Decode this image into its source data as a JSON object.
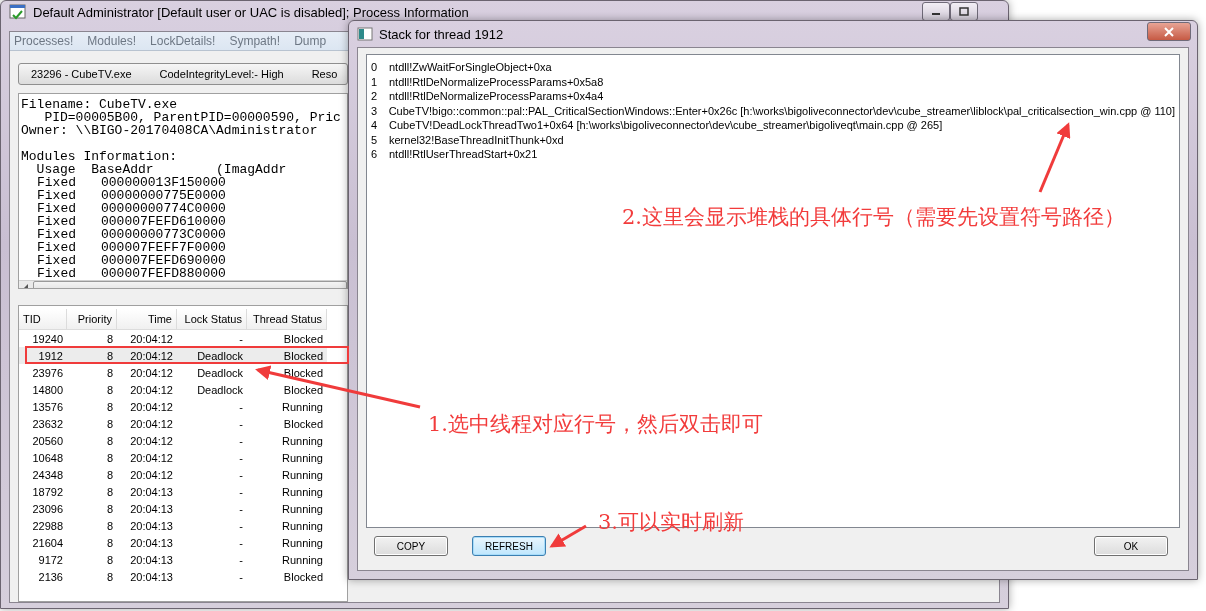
{
  "main_window": {
    "title": "Default Administrator [Default user or UAC is disabled]; Process Information",
    "menu": [
      "Processes!",
      "Modules!",
      "LockDetails!",
      "Sympath!",
      "Dump"
    ],
    "process_bar": [
      "23296 - CubeTV.exe",
      "CodeIntegrityLevel:- High",
      "Reso"
    ],
    "file_info": [
      "Filename: CubeTV.exe",
      "   PID=00005B00, ParentPID=00000590, Pric",
      "Owner: \\\\BIGO-20170408CA\\Administrator"
    ],
    "modules_heading": "Modules Information:",
    "modules_header": "  Usage  BaseAddr        (ImagAddr",
    "modules": [
      {
        "usage": "Fixed",
        "base": "000000013F150000"
      },
      {
        "usage": "Fixed",
        "base": "00000000775E0000"
      },
      {
        "usage": "Fixed",
        "base": "00000000774C0000"
      },
      {
        "usage": "Fixed",
        "base": "000007FEFD610000"
      },
      {
        "usage": "Fixed",
        "base": "00000000773C0000"
      },
      {
        "usage": "Fixed",
        "base": "000007FEFF7F0000"
      },
      {
        "usage": "Fixed",
        "base": "000007FEFD690000"
      },
      {
        "usage": "Fixed",
        "base": "000007FEFD880000"
      }
    ],
    "thread_columns": [
      "TID",
      "Priority",
      "Time",
      "Lock Status",
      "Thread Status"
    ],
    "threads": [
      {
        "tid": "19240",
        "priority": "8",
        "time": "20:04:12",
        "lock": "-",
        "status": "Blocked",
        "selected": false
      },
      {
        "tid": "1912",
        "priority": "8",
        "time": "20:04:12",
        "lock": "Deadlock",
        "status": "Blocked",
        "selected": true
      },
      {
        "tid": "23976",
        "priority": "8",
        "time": "20:04:12",
        "lock": "Deadlock",
        "status": "Blocked",
        "selected": false
      },
      {
        "tid": "14800",
        "priority": "8",
        "time": "20:04:12",
        "lock": "Deadlock",
        "status": "Blocked",
        "selected": false
      },
      {
        "tid": "13576",
        "priority": "8",
        "time": "20:04:12",
        "lock": "-",
        "status": "Running",
        "selected": false
      },
      {
        "tid": "23632",
        "priority": "8",
        "time": "20:04:12",
        "lock": "-",
        "status": "Blocked",
        "selected": false
      },
      {
        "tid": "20560",
        "priority": "8",
        "time": "20:04:12",
        "lock": "-",
        "status": "Running",
        "selected": false
      },
      {
        "tid": "10648",
        "priority": "8",
        "time": "20:04:12",
        "lock": "-",
        "status": "Running",
        "selected": false
      },
      {
        "tid": "24348",
        "priority": "8",
        "time": "20:04:12",
        "lock": "-",
        "status": "Running",
        "selected": false
      },
      {
        "tid": "18792",
        "priority": "8",
        "time": "20:04:13",
        "lock": "-",
        "status": "Running",
        "selected": false
      },
      {
        "tid": "23096",
        "priority": "8",
        "time": "20:04:13",
        "lock": "-",
        "status": "Running",
        "selected": false
      },
      {
        "tid": "22988",
        "priority": "8",
        "time": "20:04:13",
        "lock": "-",
        "status": "Running",
        "selected": false
      },
      {
        "tid": "21604",
        "priority": "8",
        "time": "20:04:13",
        "lock": "-",
        "status": "Running",
        "selected": false
      },
      {
        "tid": "9172",
        "priority": "8",
        "time": "20:04:13",
        "lock": "-",
        "status": "Running",
        "selected": false
      },
      {
        "tid": "2136",
        "priority": "8",
        "time": "20:04:13",
        "lock": "-",
        "status": "Blocked",
        "selected": false
      }
    ]
  },
  "stack_dialog": {
    "title": "Stack for thread 1912",
    "frames": [
      {
        "index": "0",
        "text": "ntdll!ZwWaitForSingleObject+0xa"
      },
      {
        "index": "1",
        "text": "ntdll!RtlDeNormalizeProcessParams+0x5a8"
      },
      {
        "index": "2",
        "text": "ntdll!RtlDeNormalizeProcessParams+0x4a4"
      },
      {
        "index": "3",
        "text": "CubeTV!bigo::common::pal::PAL_CriticalSectionWindows::Enter+0x26c [h:\\works\\bigoliveconnector\\dev\\cube_streamer\\liblock\\pal_criticalsection_win.cpp @ 110]"
      },
      {
        "index": "4",
        "text": "CubeTV!DeadLockThreadTwo1+0x64 [h:\\works\\bigoliveconnector\\dev\\cube_streamer\\bigoliveqt\\main.cpp @ 265]"
      },
      {
        "index": "5",
        "text": "kernel32!BaseThreadInitThunk+0xd"
      },
      {
        "index": "6",
        "text": "ntdll!RtlUserThreadStart+0x21"
      }
    ],
    "buttons": [
      {
        "label": "COPY",
        "focused": false
      },
      {
        "label": "REFRESH",
        "focused": true
      },
      {
        "label": "OK",
        "focused": false
      }
    ]
  },
  "annotations": [
    "1.选中线程对应行号，然后双击即可",
    "2.这里会显示堆栈的具体行号（需要先设置符号路径）",
    "3.可以实时刷新"
  ]
}
